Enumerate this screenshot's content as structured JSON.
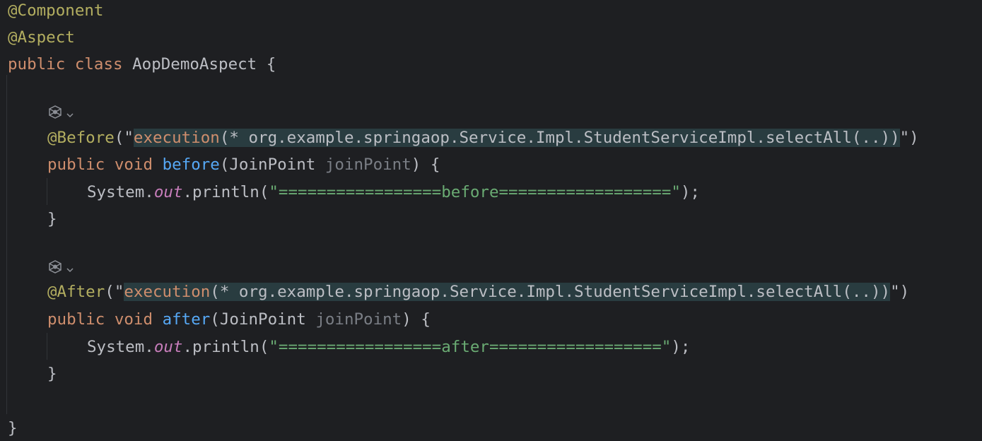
{
  "code": {
    "line1": {
      "annotation": "@Component"
    },
    "line2": {
      "annotation": "@Aspect"
    },
    "line3": {
      "kw_public": "public",
      "kw_class": "class",
      "class_name": " AopDemoAspect {"
    },
    "line5": {
      "annotation": "@Before",
      "open": "(\"",
      "inj_kw": "execution",
      "inj_rest": "(* org.example.springaop.Service.Impl.StudentServiceImpl.selectAll(..))",
      "close": "\")"
    },
    "line6": {
      "kw_public": "public",
      "kw_void": "void",
      "method": "before",
      "sig_start": "(JoinPoint ",
      "param": "joinPoint",
      "sig_end": ") {"
    },
    "line7": {
      "prefix": "System.",
      "field": "out",
      "call": ".println(",
      "string": "\"=================before==================\"",
      "end": ");"
    },
    "line8": {
      "brace": "}"
    },
    "line10": {
      "annotation": "@After",
      "open": "(\"",
      "inj_kw": "execution",
      "inj_rest": "(* org.example.springaop.Service.Impl.StudentServiceImpl.selectAll(..))",
      "close": "\")"
    },
    "line11": {
      "kw_public": "public",
      "kw_void": "void",
      "method": "after",
      "sig_start": "(JoinPoint ",
      "param": "joinPoint",
      "sig_end": ") {"
    },
    "line12": {
      "prefix": "System.",
      "field": "out",
      "call": ".println(",
      "string": "\"=================after==================\"",
      "end": ");"
    },
    "line13": {
      "brace": "}"
    },
    "line15": {
      "brace": "}"
    }
  },
  "gutter": {
    "icon1": "aspect-gutter-icon",
    "icon2": "aspect-gutter-icon"
  },
  "colors": {
    "background": "#1e1f22",
    "annotation": "#b3ae60",
    "keyword": "#cf8e6d",
    "method": "#56a8f5",
    "string": "#6aab73",
    "static_field": "#c77dbb",
    "parameter": "#7a7e85",
    "injection_bg": "#293c40"
  }
}
